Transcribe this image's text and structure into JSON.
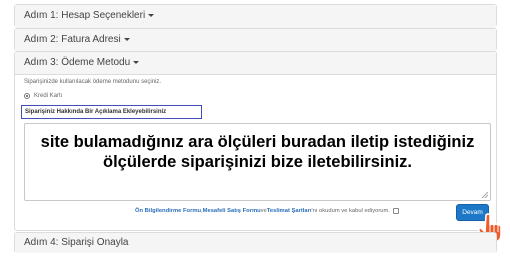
{
  "steps": [
    {
      "label": "Adım 1: Hesap Seçenekleri"
    },
    {
      "label": "Adım 2: Fatura Adresi"
    },
    {
      "label": "Adım 3: Ödeme Metodu"
    },
    {
      "label": "Adım 4: Siparişi Onayla"
    }
  ],
  "payment": {
    "description": "Siparişinizde kullanılacak ödeme metodunu seçiniz.",
    "method_label": "Kredi Kartı",
    "note_label": "Siparişiniz Hakkında Bir Açıklama Ekleyebilirsiniz",
    "note_text": "site bulamadığınız ara ölçüleri buradan iletip istediğiniz ölçülerde siparişinizi bize iletebilirsiniz."
  },
  "terms": {
    "link1": "Ön Bilgilendirme Formu",
    "sep1": ", ",
    "link2": "Mesafeli Satış Formu",
    "sep2": " ve ",
    "link3": "Teslimat Şartları",
    "suffix": "'nı okudum ve kabul ediyorum."
  },
  "continue_label": "Devam",
  "colors": {
    "accent": "#1e78c8",
    "link": "#2a6ebb",
    "note_border": "#3f51b5",
    "cursor": "#f05a28"
  }
}
